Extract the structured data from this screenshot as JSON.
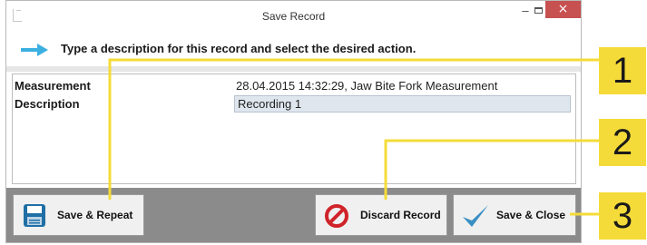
{
  "window": {
    "title": "Save Record",
    "controls": {
      "minimize": "–",
      "close": "×"
    }
  },
  "instruction": {
    "icon": "arrow-right-icon",
    "text": "Type a description for this record and select the desired action."
  },
  "fields": {
    "measurement_label": "Measurement",
    "measurement_value": "28.04.2015 14:32:29, Jaw Bite Fork Measurement",
    "description_label": "Description",
    "description_value": "Recording 1"
  },
  "buttons": {
    "save_repeat": {
      "label": "Save & Repeat",
      "icon": "floppy-disk-icon"
    },
    "discard": {
      "label": "Discard Record",
      "icon": "no-sign-icon"
    },
    "save_close": {
      "label": "Save & Close",
      "icon": "checkmark-icon"
    }
  },
  "callouts": [
    "1",
    "2",
    "3"
  ],
  "colors": {
    "callout": "#f5db39",
    "arrow": "#3bb0e0",
    "close_button": "#c75050",
    "footer": "#8b8b8b",
    "description_input": "#dfe6ee",
    "discard_icon": "#d0232a",
    "check_icon": "#3a8fc4"
  }
}
